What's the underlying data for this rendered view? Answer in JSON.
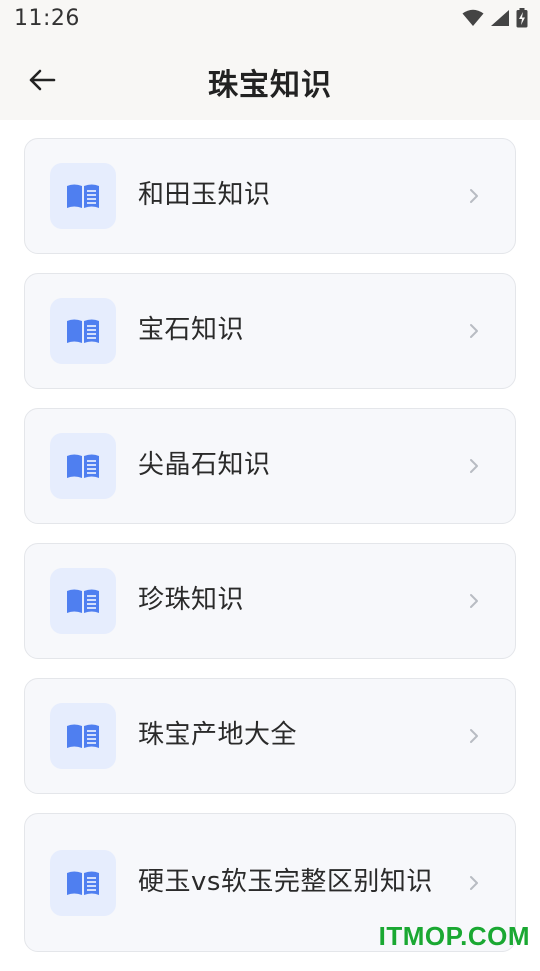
{
  "status_bar": {
    "time": "11:26",
    "icons": [
      "wifi-icon",
      "signal-icon",
      "battery-charging-icon"
    ]
  },
  "header": {
    "back_icon": "arrow-left-icon",
    "title": "珠宝知识"
  },
  "list": {
    "item_icon": "open-book-icon",
    "chevron_icon": "chevron-right-icon",
    "accent_color": "#4f7ff0",
    "items": [
      {
        "label": "和田玉知识"
      },
      {
        "label": "宝石知识"
      },
      {
        "label": "尖晶石知识"
      },
      {
        "label": "珍珠知识"
      },
      {
        "label": "珠宝产地大全"
      },
      {
        "label": "硬玉vs软玉完整区别知识"
      }
    ]
  },
  "watermark": {
    "text": "ITMOP.COM",
    "color": "#1aa832"
  }
}
